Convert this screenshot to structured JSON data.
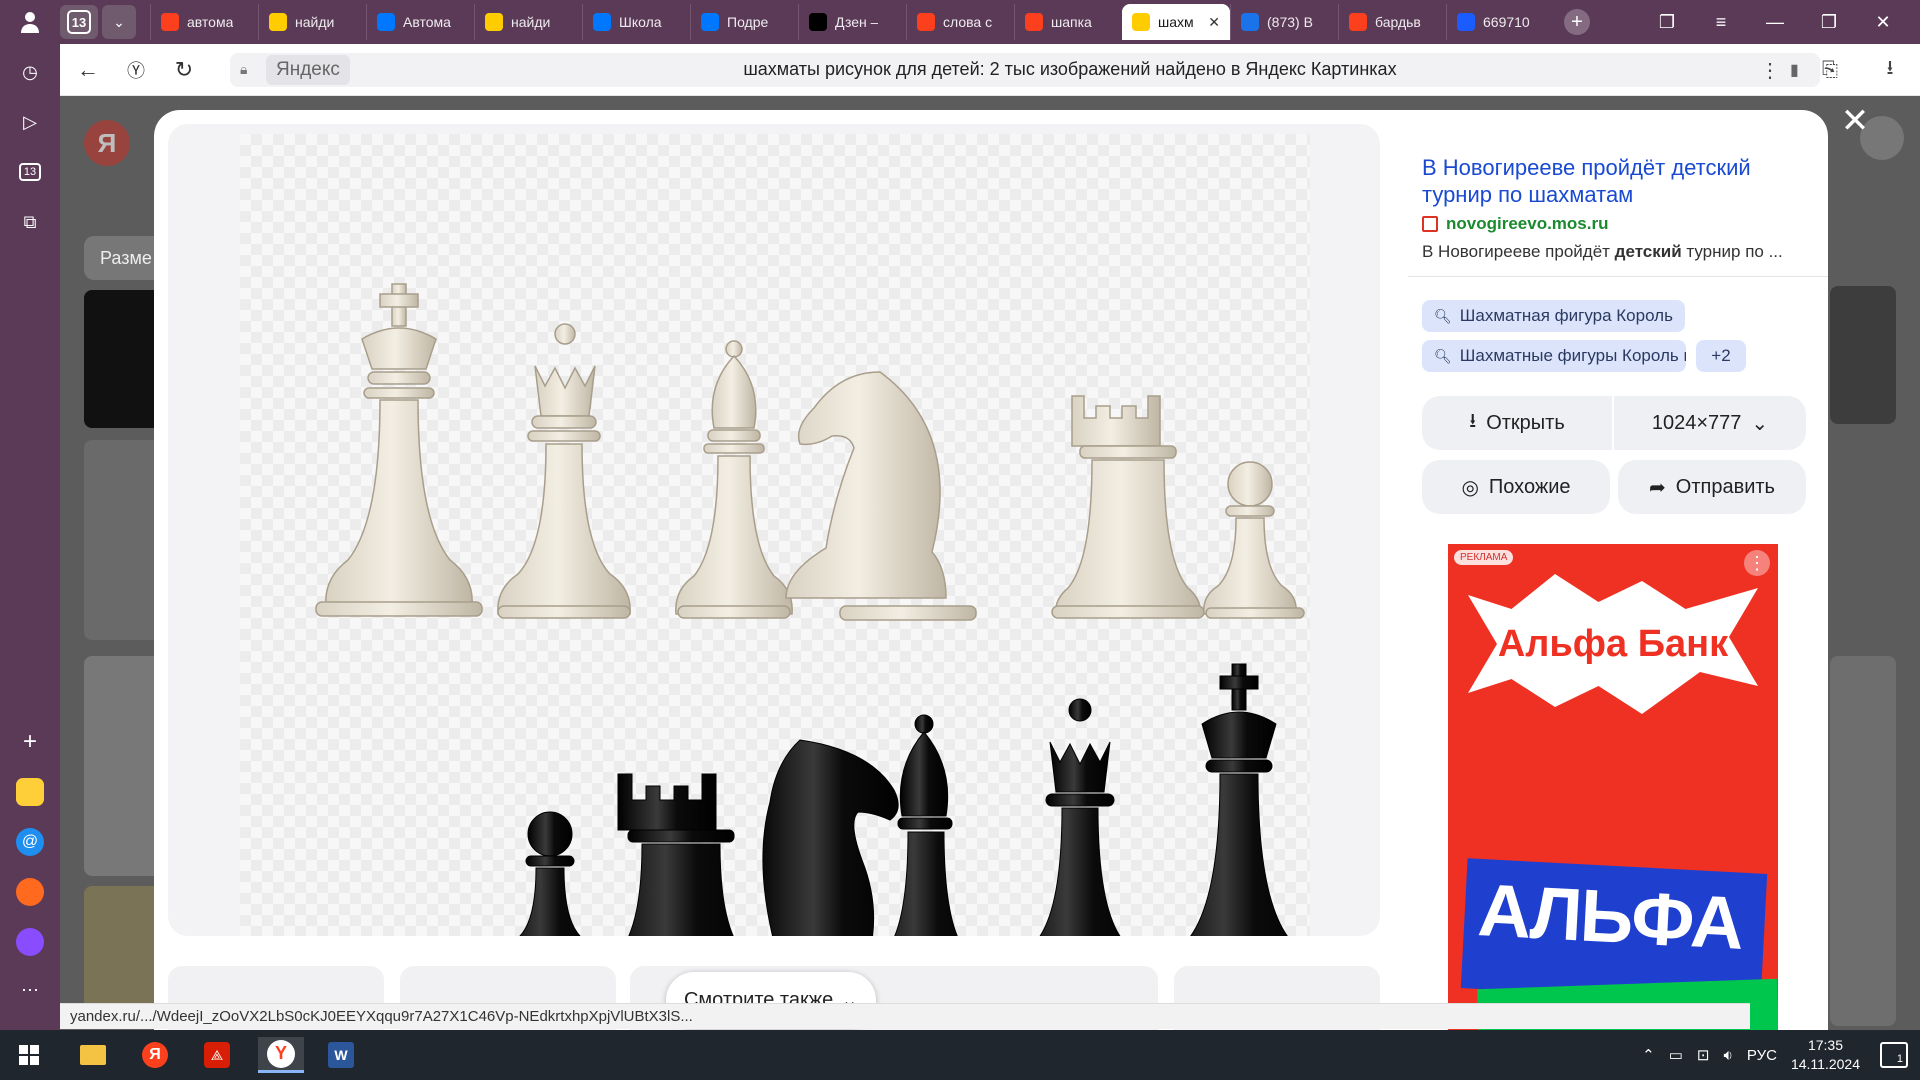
{
  "browser": {
    "tab_count": "13",
    "tabs": [
      {
        "label": "автома",
        "icon": "yandex-icon",
        "color": "#fc3f1d"
      },
      {
        "label": "найди",
        "icon": "images-icon",
        "color": "#ffcc00"
      },
      {
        "label": "Автома",
        "icon": "vk-icon",
        "color": "#0077ff"
      },
      {
        "label": "найди",
        "icon": "images-icon",
        "color": "#ffcc00"
      },
      {
        "label": "Школа",
        "icon": "vk-icon",
        "color": "#0077ff"
      },
      {
        "label": "Подре",
        "icon": "vk-icon",
        "color": "#0077ff"
      },
      {
        "label": "Дзен –",
        "icon": "zen-icon",
        "color": "#000000"
      },
      {
        "label": "слова с",
        "icon": "yandex-icon",
        "color": "#fc3f1d"
      },
      {
        "label": "шапка",
        "icon": "yandex-icon",
        "color": "#fc3f1d"
      },
      {
        "label": "шахм",
        "icon": "images-icon",
        "color": "#ffcc00",
        "active": true
      },
      {
        "label": "(873) В",
        "icon": "mail-icon",
        "color": "#1a73e8"
      },
      {
        "label": "бардьв",
        "icon": "yandex-icon",
        "color": "#fc3f1d"
      },
      {
        "label": "669710",
        "icon": "ring-icon",
        "color": "#1a5cff"
      }
    ],
    "address": {
      "site": "Яндекс",
      "title": "шахматы рисунок для детей: 2 тыс изображений найдено в Яндекс Картинках"
    },
    "status_url": "yandex.ru/.../WdeejI_zOoVX2LbS0cKJ0EEYXqqu9r7A27X1C46Vp-NEdkrtxhpXpjVlUBtX3lS..."
  },
  "background_page": {
    "filter_label": "Разме"
  },
  "viewer": {
    "image_alt": "chess pieces white and black",
    "source": {
      "title": "В Новогирееве пройдёт детский турнир по шахматам",
      "domain": "novogireevo.mos.ru",
      "desc_before": "В Новогирееве пройдёт ",
      "desc_bold": "детский",
      "desc_after": " турнир по ..."
    },
    "chips": [
      "Шахматная фигура Король",
      "Шахматные фигуры Король и ф..."
    ],
    "chips_more": "+2",
    "actions": {
      "open_label": "Открыть",
      "size_label": "1024×777",
      "similar_label": "Похожие",
      "share_label": "Отправить"
    },
    "ad": {
      "badge": "РЕКЛАМА",
      "brand": "Альфа Банк",
      "headline": "АЛЬФА"
    },
    "see_also_label": "Смотрите также"
  },
  "taskbar": {
    "lang": "РУС",
    "time": "17:35",
    "date": "14.11.2024",
    "notifications": "1"
  },
  "colors": {
    "tabbar": "#5b3a57",
    "link": "#1a4ad1",
    "domain": "#1b8a2f",
    "chip": "#dbe4fb",
    "ad": "#ef3124"
  }
}
